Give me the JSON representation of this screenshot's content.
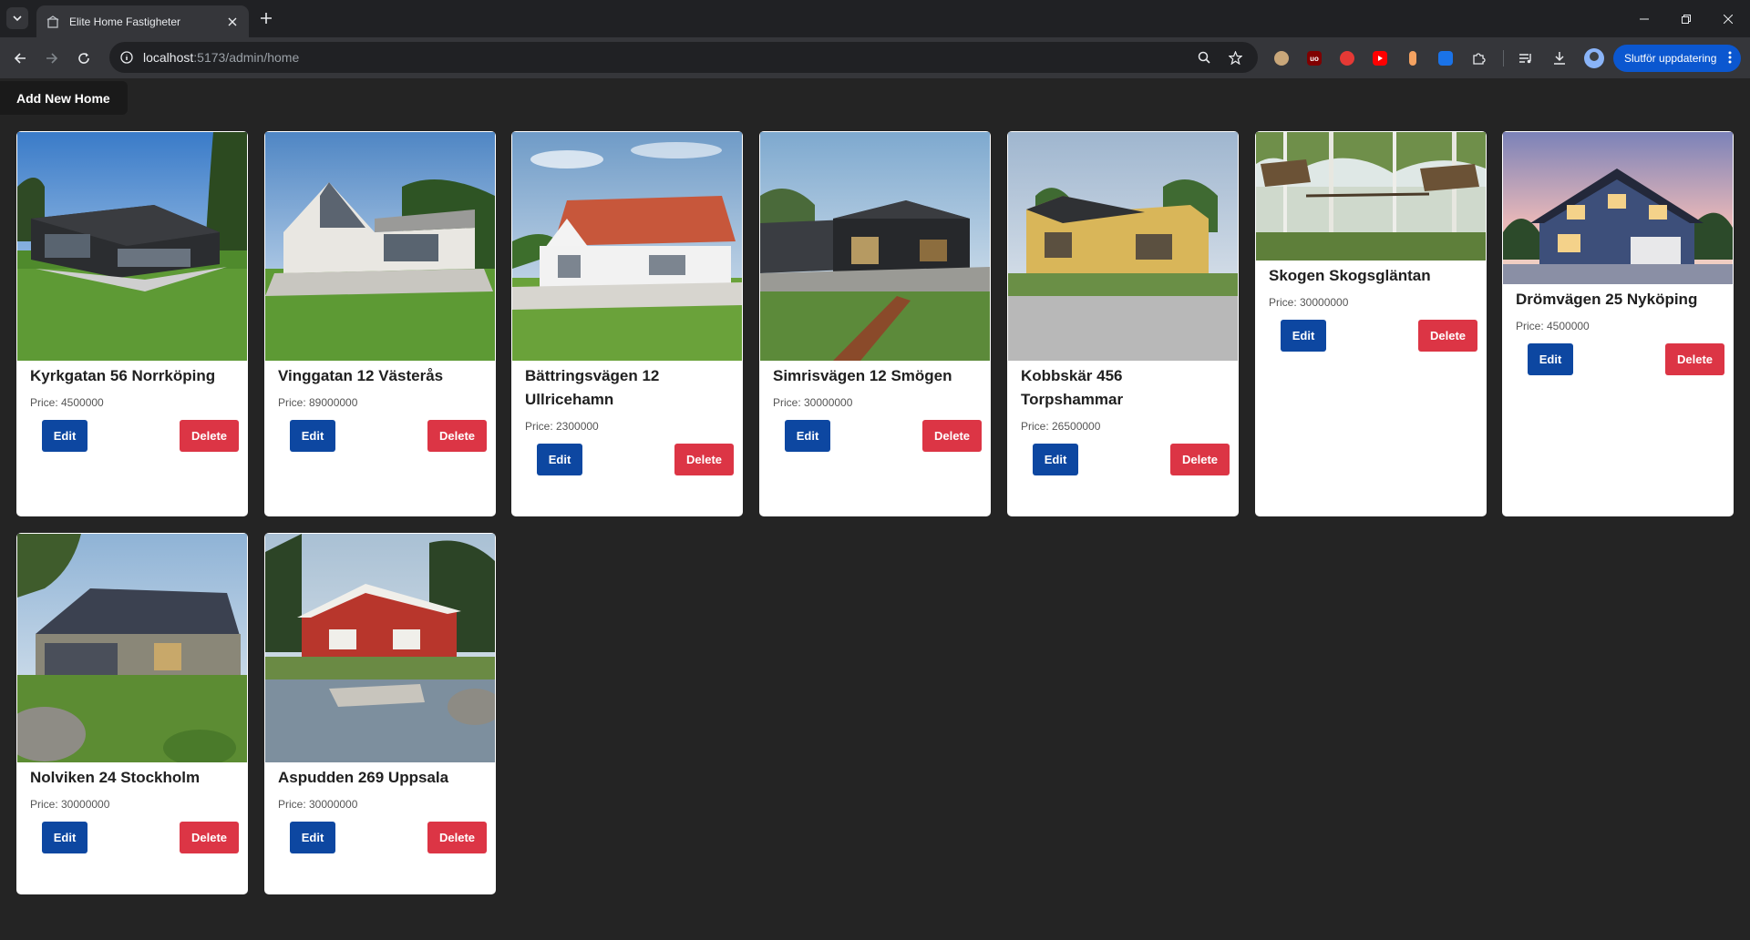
{
  "browser": {
    "tab_title": "Elite Home Fastigheter",
    "url_host": "localhost",
    "url_rest": ":5173/admin/home",
    "update_label": "Slutför uppdatering"
  },
  "page": {
    "add_button_label": "Add New Home",
    "price_prefix": "Price: ",
    "edit_label": "Edit",
    "delete_label": "Delete"
  },
  "homes": [
    {
      "name": "Kyrkgatan 56 Norrköping",
      "price": "Price: 4500000",
      "image": "dark modern bungalow on green slope"
    },
    {
      "name": "Vinggatan 12 Västerås",
      "price": "Price: 89000000",
      "image": "white house with large glass gable"
    },
    {
      "name": "Bättringsvägen 12 Ullricehamn",
      "price": "Price: 2300000",
      "image": "white villa with red tile roof"
    },
    {
      "name": "Simrisvägen 12 Smögen",
      "price": "Price: 30000000",
      "image": "black wooden house with pergola"
    },
    {
      "name": "Kobbskär 456 Torpshammar",
      "price": "Price: 26500000",
      "image": "yellow one-storey house"
    },
    {
      "name": "Skogen Skogsgläntan",
      "price": "Price: 30000000",
      "image": "tree houses in birch forest"
    },
    {
      "name": "Drömvägen 25 Nyköping",
      "price": "Price: 4500000",
      "image": "blue two-storey house at dusk"
    },
    {
      "name": "Nolviken 24 Stockholm",
      "price": "Price: 30000000",
      "image": "grey house in meadow with rocks"
    },
    {
      "name": "Aspudden 269 Uppsala",
      "price": "Price: 30000000",
      "image": "red cottage by lake with jetty"
    }
  ]
}
